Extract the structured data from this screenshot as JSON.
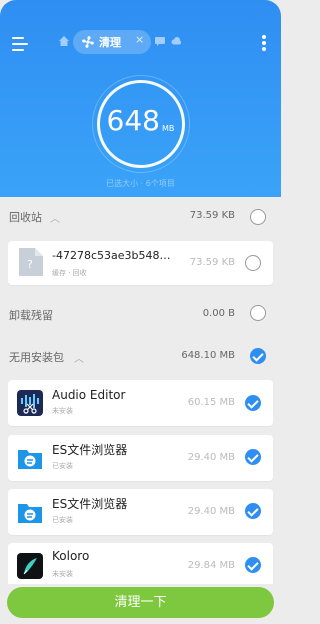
{
  "header": {
    "tab_label": "清理",
    "tab_close": "×",
    "total_size": "648",
    "total_unit": "MB",
    "sub_info": "已选大小 · 6个项目"
  },
  "sections": {
    "recycle": {
      "title": "回收站",
      "size": "73.59 KB",
      "checked": false
    },
    "recycle_item": {
      "name": "-47278c53ae3b548…",
      "meta": "缓存 · 回收",
      "size": "73.59 KB",
      "checked": false
    },
    "uninstall": {
      "title": "卸载残留",
      "size": "0.00 B",
      "checked": false
    },
    "apk": {
      "title": "无用安装包",
      "size": "648.10 MB",
      "checked": true
    }
  },
  "apk_items": [
    {
      "name": "Audio Editor",
      "meta": "未安装",
      "size": "60.15 MB",
      "checked": true,
      "icon": "audio-editor-icon"
    },
    {
      "name": "ES文件浏览器",
      "meta": "已安装",
      "size": "29.40 MB",
      "checked": true,
      "icon": "es-file-explorer-icon"
    },
    {
      "name": "ES文件浏览器",
      "meta": "已安装",
      "size": "29.40 MB",
      "checked": true,
      "icon": "es-file-explorer-icon"
    },
    {
      "name": "Koloro",
      "meta": "未安装",
      "size": "29.84 MB",
      "checked": true,
      "icon": "koloro-icon"
    }
  ],
  "bottom": {
    "clean_label": "清理一下"
  },
  "colors": {
    "header_blue": "#2f8ef2",
    "check_blue": "#2f8ef2",
    "button_green": "#7dc83f"
  }
}
